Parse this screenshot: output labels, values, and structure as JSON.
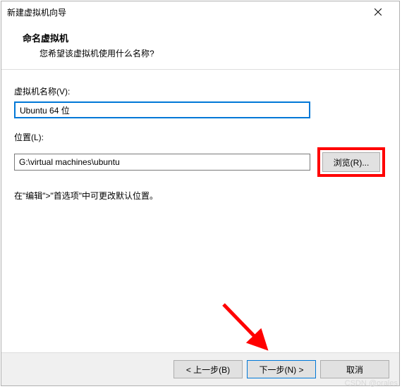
{
  "window": {
    "title": "新建虚拟机向导"
  },
  "header": {
    "title": "命名虚拟机",
    "subtitle": "您希望该虚拟机使用什么名称?"
  },
  "fields": {
    "name_label": "虚拟机名称(V):",
    "name_value": "Ubuntu 64 位",
    "location_label": "位置(L):",
    "location_value": "G:\\virtual machines\\ubuntu",
    "browse_label": "浏览(R)..."
  },
  "hint": "在\"编辑\">\"首选项\"中可更改默认位置。",
  "footer": {
    "back": "< 上一步(B)",
    "next": "下一步(N) >",
    "cancel": "取消"
  },
  "watermark": "CSDN @orales"
}
